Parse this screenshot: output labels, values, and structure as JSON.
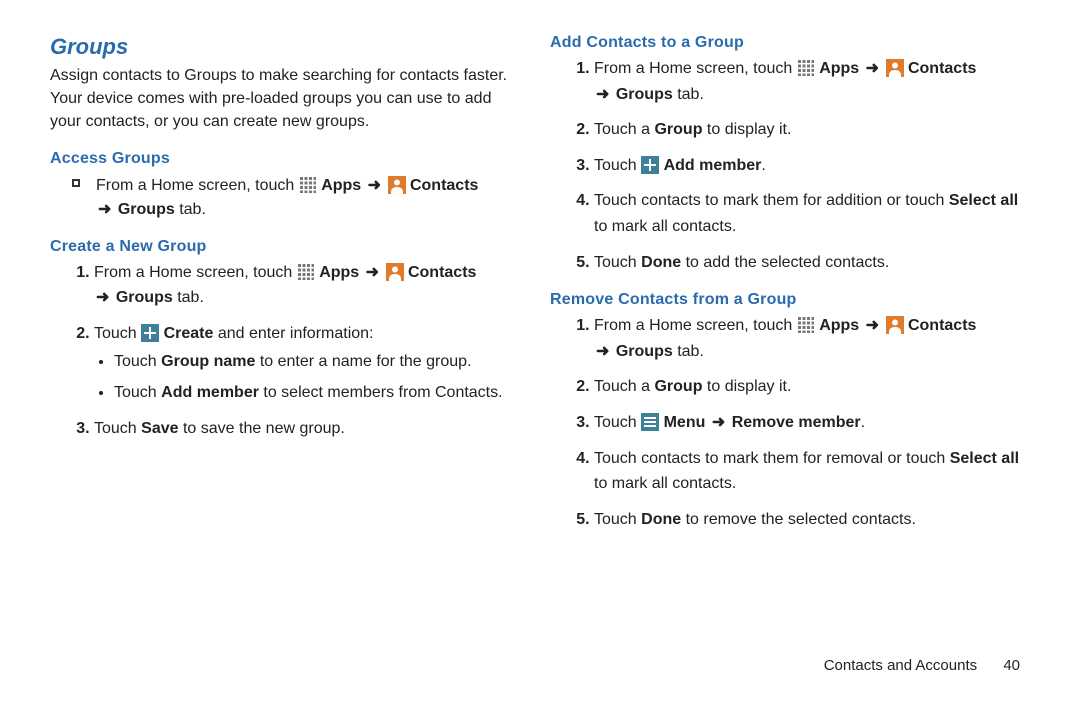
{
  "colors": {
    "blue": "#2a6bae",
    "orange": "#e07b2c",
    "teal": "#3f7f99"
  },
  "icons": {
    "apps": "apps-icon",
    "contacts": "contacts-icon",
    "plus": "plus-icon",
    "menu": "menu-icon"
  },
  "section_title": "Groups",
  "intro": "Assign contacts to Groups to make searching for contacts faster. Your device comes with pre-loaded groups you can use to add your contacts, or you can create new groups.",
  "arrow": "➜",
  "common": {
    "from_home_prefix": "From a Home screen, touch ",
    "apps_label": "Apps",
    "contacts_label": "Contacts",
    "groups_tab_label": "Groups",
    "tab_word": " tab.",
    "touch_word": "Touch ",
    "touch_a_group": "Touch a ",
    "group_word": "Group",
    "to_display": " to display it.",
    "select_all": "Select all",
    "done_word": "Done"
  },
  "access": {
    "heading": "Access Groups"
  },
  "create": {
    "heading": "Create a New Group",
    "step2_prefix": "Touch ",
    "step2_bold": "Create",
    "step2_suffix": " and enter information:",
    "bullet1_pre": "Touch ",
    "bullet1_bold": "Group name",
    "bullet1_post": " to enter a name for the group.",
    "bullet2_pre": "Touch ",
    "bullet2_bold": "Add member",
    "bullet2_post": " to select members from Contacts.",
    "step3_pre": "Touch ",
    "step3_bold": "Save",
    "step3_post": " to save the new group."
  },
  "add": {
    "heading": "Add Contacts to a Group",
    "step3_pre": "Touch ",
    "step3_bold": "Add member",
    "step3_post": ".",
    "step4_pre": "Touch contacts to mark them for addition or touch ",
    "step4_post": " to mark all contacts.",
    "step5_pre": "Touch ",
    "step5_post": " to add the selected contacts."
  },
  "remove": {
    "heading": "Remove Contacts from a Group",
    "step3_pre": "Touch ",
    "step3_menu": "Menu",
    "step3_remove": "Remove member",
    "step3_post": ".",
    "step4_pre": "Touch contacts to mark them for removal or touch ",
    "step4_post": " to mark all contacts.",
    "step5_pre": "Touch ",
    "step5_post": " to remove the selected contacts."
  },
  "footer": {
    "chapter": "Contacts and Accounts",
    "page": "40"
  }
}
